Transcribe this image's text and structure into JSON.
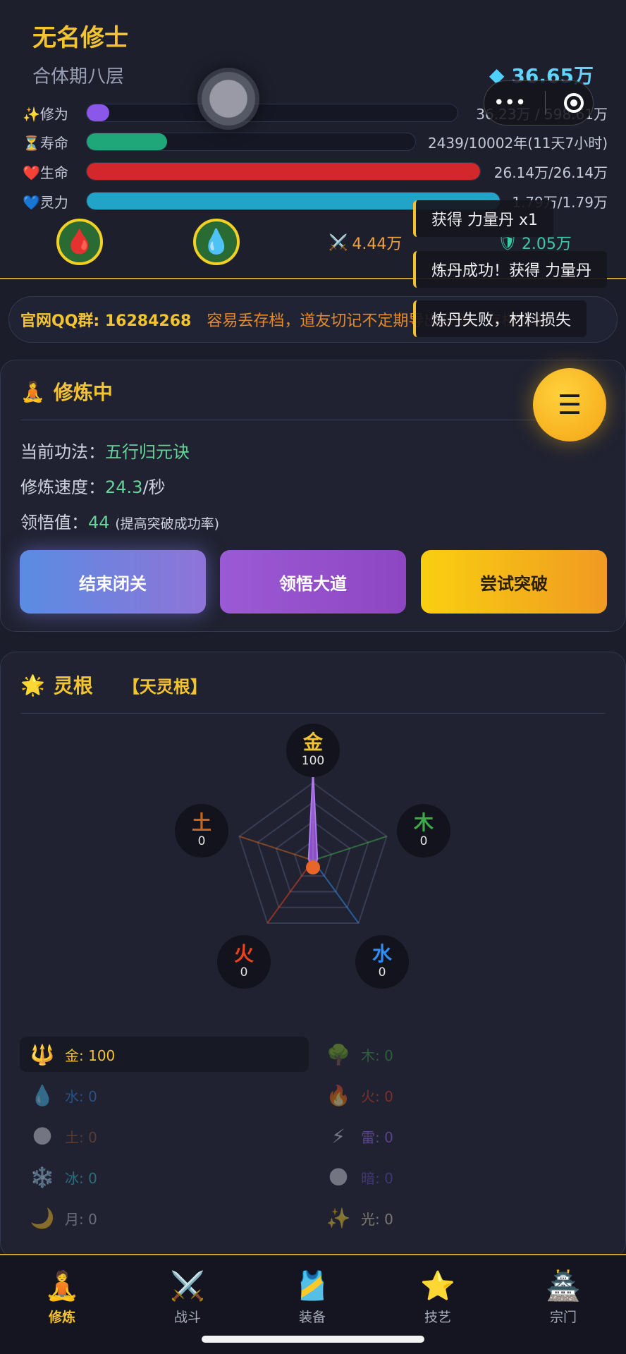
{
  "player": {
    "name": "无名修士",
    "realm": "合体期八层",
    "spirit_stones": "36.65万"
  },
  "stats": [
    {
      "icon": "✨",
      "label": "修为",
      "value": "36.23万 / 598.61万",
      "fill": 0.061,
      "color": "#8a57e8",
      "bar_end": 650
    },
    {
      "icon": "⏳",
      "label": "寿命",
      "value": "2439/10002年(11天7小时)",
      "fill": 0.244,
      "color": "#1fa77a",
      "bar_end": 590
    },
    {
      "icon": "❤️",
      "label": "生命",
      "value": "26.14万/26.14万",
      "fill": 1.0,
      "color": "#d2282b",
      "bar_end": 682
    },
    {
      "icon": "💙",
      "label": "灵力",
      "value": "1.79万/1.79万",
      "fill": 1.0,
      "color": "#22a3c8",
      "bar_end": 710
    }
  ],
  "combat": {
    "attack": "4.44万",
    "defense": "2.05万"
  },
  "toasts": [
    "获得 力量丹 x1",
    "炼丹成功！获得 力量丹",
    "炼丹失败，材料损失"
  ],
  "marquee": {
    "qq": "官网QQ群: 16284268",
    "notice": "容易丢存档，道友切记不定期导出存档，存档管理"
  },
  "cultivation": {
    "title": "修炼中",
    "method_label": "当前功法：",
    "method": "五行归元诀",
    "speed_label": "修炼速度：",
    "speed": "24.3",
    "speed_unit": "/秒",
    "insight_label": "领悟值：",
    "insight": "44",
    "insight_note": "(提高突破成功率)",
    "buttons": {
      "end": "结束闭关",
      "dao": "领悟大道",
      "break": "尝试突破"
    }
  },
  "spirit_root": {
    "title": "灵根",
    "tag": "【天灵根】",
    "radar": [
      {
        "name": "金",
        "value": "100",
        "color": "#f4c430"
      },
      {
        "name": "木",
        "value": "0",
        "color": "#3ea84a"
      },
      {
        "name": "水",
        "value": "0",
        "color": "#2f8cf0"
      },
      {
        "name": "火",
        "value": "0",
        "color": "#e8421f"
      },
      {
        "name": "土",
        "value": "0",
        "color": "#c8641e"
      }
    ],
    "elements": [
      {
        "icon": "🔱",
        "text": "金: 100",
        "color": "#f4c430",
        "active": true
      },
      {
        "icon": "🌳",
        "text": "木: 0",
        "color": "#3ea84a",
        "active": false
      },
      {
        "icon": "💧",
        "text": "水: 0",
        "color": "#2f8cf0",
        "active": false
      },
      {
        "icon": "🔥",
        "text": "火: 0",
        "color": "#e8421f",
        "active": false
      },
      {
        "icon": "🌑",
        "text": "土: 0",
        "color": "#a35a2a",
        "active": false
      },
      {
        "icon": "⚡",
        "text": "雷: 0",
        "color": "#9b6cf0",
        "active": false
      },
      {
        "icon": "❄️",
        "text": "冰: 0",
        "color": "#3cc6d8",
        "active": false
      },
      {
        "icon": "🌑",
        "text": "暗: 0",
        "color": "#6a4fc0",
        "active": false
      },
      {
        "icon": "🌙",
        "text": "月: 0",
        "color": "#c8c8d8",
        "active": false
      },
      {
        "icon": "✨",
        "text": "光: 0",
        "color": "#e8e0b8",
        "active": false
      }
    ]
  },
  "tabs": [
    {
      "icon": "🧘",
      "label": "修炼",
      "active": true
    },
    {
      "icon": "⚔️",
      "label": "战斗",
      "active": false
    },
    {
      "icon": "🎽",
      "label": "装备",
      "active": false
    },
    {
      "icon": "⭐",
      "label": "技艺",
      "active": false
    },
    {
      "icon": "🏯",
      "label": "宗门",
      "active": false
    }
  ]
}
